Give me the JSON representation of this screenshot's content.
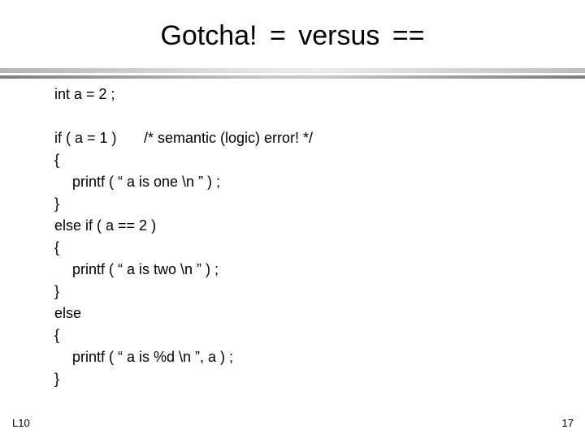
{
  "slide": {
    "title": "Gotcha!  =  versus  ==",
    "code_lines": [
      {
        "text": "int a = 2 ;",
        "indent": false
      },
      {
        "text": "",
        "indent": false
      },
      {
        "text": "if ( a = 1 )",
        "indent": false,
        "comment": "/* semantic (logic) error! */"
      },
      {
        "text": "{",
        "indent": false
      },
      {
        "text": "printf ( “ a is one \\n ” ) ;",
        "indent": true
      },
      {
        "text": "}",
        "indent": false
      },
      {
        "text": "else if ( a == 2 )",
        "indent": false
      },
      {
        "text": "{",
        "indent": false
      },
      {
        "text": "printf ( “ a is two \\n ” ) ;",
        "indent": true
      },
      {
        "text": "}",
        "indent": false
      },
      {
        "text": "else",
        "indent": false
      },
      {
        "text": "{",
        "indent": false
      },
      {
        "text": "printf ( “ a is %d \\n ”, a ) ;",
        "indent": true
      },
      {
        "text": "}",
        "indent": false
      }
    ],
    "footer_left": "L10",
    "page_number": "17"
  }
}
